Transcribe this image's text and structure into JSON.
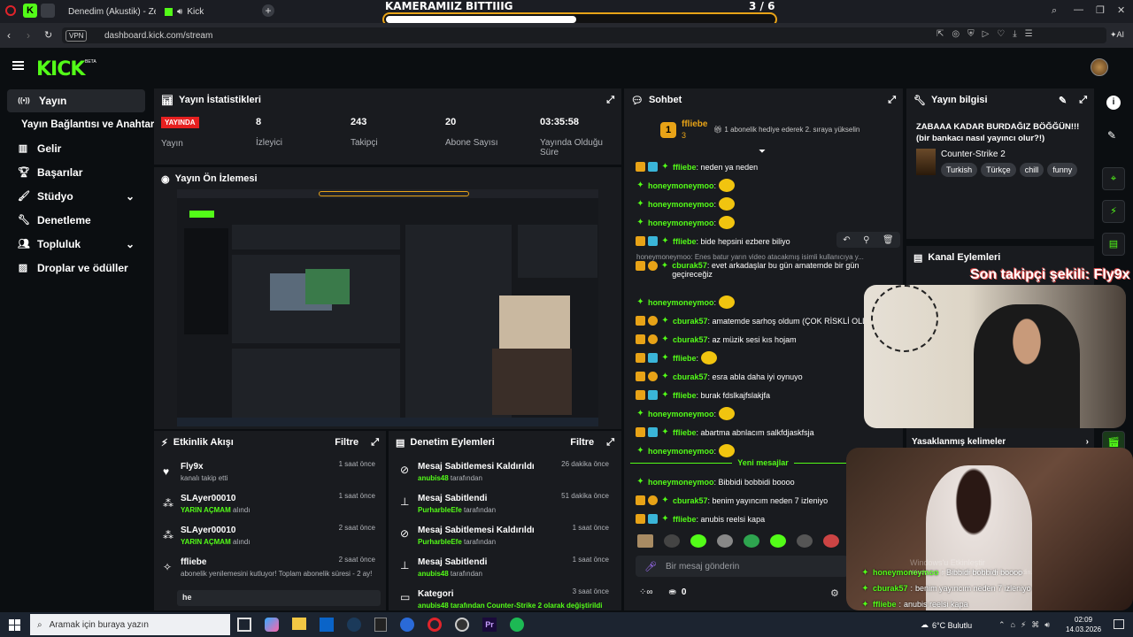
{
  "browser": {
    "tabs": [
      {
        "label": "Denedim (Akustik) - Zeyn"
      },
      {
        "label": "Kick"
      }
    ],
    "url": "dashboard.kick.com/stream",
    "vpn_label": "VPN",
    "ai_label": "AI"
  },
  "overlay": {
    "title": "KAMERAMIIZ BITTIIIG",
    "counter": "3 / 6",
    "progress": 0.49,
    "follower_banner": "Son takipçi şekili: Fly9x"
  },
  "brand": {
    "logo": "KICK",
    "beta": "BETA"
  },
  "sidebar": {
    "items": [
      {
        "label": "Yayın",
        "icon": "broadcast-icon",
        "active": true
      },
      {
        "label": "Yayın Bağlantısı ve Anahtarı",
        "icon": "",
        "active": false
      },
      {
        "label": "Gelir",
        "icon": "chart-icon",
        "active": false
      },
      {
        "label": "Başarılar",
        "icon": "trophy-icon",
        "active": false
      },
      {
        "label": "Stüdyo",
        "icon": "brush-icon",
        "active": false
      },
      {
        "label": "Denetleme",
        "icon": "wrench-icon",
        "active": false
      },
      {
        "label": "Topluluk",
        "icon": "people-icon",
        "active": false
      },
      {
        "label": "Droplar ve ödüller",
        "icon": "gift-icon",
        "active": false
      }
    ]
  },
  "stats": {
    "title": "Yayın İstatistikleri",
    "live_badge": "YAYINDA",
    "items": [
      {
        "value": "",
        "label": "Yayın"
      },
      {
        "value": "8",
        "label": "İzleyici"
      },
      {
        "value": "243",
        "label": "Takipçi"
      },
      {
        "value": "20",
        "label": "Abone Sayısı"
      },
      {
        "value": "03:35:58",
        "label": "Yayında Olduğu Süre"
      }
    ]
  },
  "preview": {
    "title": "Yayın Ön İzlemesi"
  },
  "activity": {
    "title": "Etkinlik Akışı",
    "filter": "Filtre",
    "items": [
      {
        "name": "Fly9x",
        "detail": "kanalı takip etti",
        "green": "",
        "tail": "",
        "time": "1 saat önce",
        "icon": "heart-icon"
      },
      {
        "name": "SLAyer00010",
        "detail": "",
        "green": "YARIN AÇMAM",
        "tail": "alındı",
        "time": "1 saat önce",
        "icon": "gift-icon"
      },
      {
        "name": "SLAyer00010",
        "detail": "",
        "green": "YARIN AÇMAM",
        "tail": "alındı",
        "time": "2 saat önce",
        "icon": "gift-icon"
      },
      {
        "name": "ffliebe",
        "detail": "abonelik yenilemesini kutluyor! Toplam abonelik süresi - 2 ay!",
        "green": "",
        "tail": "",
        "time": "2 saat önce",
        "icon": "star-icon"
      }
    ],
    "input_value": "he"
  },
  "moderation": {
    "title": "Denetim Eylemleri",
    "filter": "Filtre",
    "items": [
      {
        "action": "Mesaj Sabitlemesi Kaldırıldı",
        "who": "anubis48",
        "suffix": "tarafından",
        "time": "26 dakika önce"
      },
      {
        "action": "Mesaj Sabitlendi",
        "who": "PurharbleEfe",
        "suffix": "tarafından",
        "time": "51 dakika önce"
      },
      {
        "action": "Mesaj Sabitlemesi Kaldırıldı",
        "who": "PurharbleEfe",
        "suffix": "tarafından",
        "time": "1 saat önce"
      },
      {
        "action": "Mesaj Sabitlendi",
        "who": "anubis48",
        "suffix": "tarafından",
        "time": "1 saat önce"
      },
      {
        "action": "Kategori",
        "who": "anubis48 tarafından Counter-Strike 2 olarak değiştirildi",
        "suffix": "",
        "time": "3 saat önce"
      }
    ]
  },
  "chat": {
    "title": "Sohbet",
    "pinned_user": "ffliebe",
    "pinned_count": "3",
    "gift_note": "1 abonelik hediye ederek 2. sıraya yükselin",
    "messages": [
      {
        "user": "ffliebe",
        "text": "neden ya neden",
        "badges": "cs",
        "emote": false
      },
      {
        "user": "honeymoneymoo",
        "text": "",
        "badges": "",
        "emote": true
      },
      {
        "user": "honeymoneymoo",
        "text": "",
        "badges": "",
        "emote": true
      },
      {
        "user": "honeymoneymoo",
        "text": "",
        "badges": "",
        "emote": true
      },
      {
        "user": "ffliebe",
        "text": "bide hepsini ezbere biliyo",
        "badges": "cs",
        "emote": false
      }
    ],
    "reply_note": "honeymoneymoo: Enes batur yarın video atacakmış isimli kullanıcıya y...",
    "messages2": [
      {
        "user": "cburak57",
        "text": "evet arkadaşlar bu gün amatemde bir gün geçireceğiz",
        "badges": "co",
        "emote": false,
        "tall": true
      },
      {
        "user": "honeymoneymoo",
        "text": "",
        "badges": "",
        "emote": true
      },
      {
        "user": "cburak57",
        "text": "amatemde sarhoş oldum (ÇOK RİSKLİ OLDU",
        "badges": "co",
        "emote": false
      },
      {
        "user": "cburak57",
        "text": "az müzik sesi kıs hojam",
        "badges": "co",
        "emote": false
      },
      {
        "user": "ffliebe",
        "text": "",
        "badges": "cs",
        "emote": true
      },
      {
        "user": "cburak57",
        "text": "esra abla daha iyi oynuyo",
        "badges": "co",
        "emote": false
      },
      {
        "user": "ffliebe",
        "text": "burak fdslkajfslakjfa",
        "badges": "cs",
        "emote": false
      },
      {
        "user": "honeymoneymoo",
        "text": "",
        "badges": "",
        "emote": true
      },
      {
        "user": "ffliebe",
        "text": "abartma abnlacım salkfdjaskfsja",
        "badges": "cs",
        "emote": false
      },
      {
        "user": "honeymoneymoo",
        "text": "",
        "badges": "",
        "emote": true
      }
    ],
    "new_messages": "Yeni mesajlar",
    "messages3": [
      {
        "user": "honeymoneymoo",
        "text": "Bibbidi bobbidi boooo",
        "badges": "",
        "emote": false
      },
      {
        "user": "cburak57",
        "text": "benim yayıncım neden 7 izleniyo",
        "badges": "co",
        "emote": false
      },
      {
        "user": "ffliebe",
        "text": "anubis reelsi kapa",
        "badges": "cs",
        "emote": false
      }
    ],
    "input_placeholder": "Bir mesaj gönderin",
    "points": "0"
  },
  "stream_info": {
    "title": "Yayın bilgisi",
    "stream_title": "ZABAAA KADAR BURDAĞIZ BÖĞĞÜN!!! (bir bankacı nasıl yayıncı olur?!)",
    "category": "Counter-Strike 2",
    "tags": [
      "Turkish",
      "Türkçe",
      "chill",
      "funny"
    ]
  },
  "channel_actions": {
    "title": "Kanal Eylemleri",
    "banned_words": "Yasaklanmış kelimeler"
  },
  "overlay_chat": [
    {
      "user": "honeymoneymoo",
      "text": "Bibbidi bobbidi boooo"
    },
    {
      "user": "cburak57",
      "text": "benim yayıncım neden 7 izleniyo"
    },
    {
      "user": "ffliebe",
      "text": "anubis reelsi kapa"
    }
  ],
  "watermark": {
    "line1": "Windows'u Etkinleştir",
    "line2": "Windows'u etkinleştirmek için Ayarlar'a gidin."
  },
  "taskbar": {
    "search_placeholder": "Aramak için buraya yazın",
    "weather": "6°C  Bulutlu",
    "time": "02:09",
    "date": "14.03.2026"
  }
}
